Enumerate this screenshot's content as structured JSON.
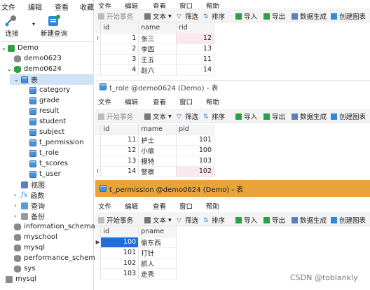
{
  "menubar": [
    "文件",
    "编辑",
    "查看",
    "收藏"
  ],
  "toolbar": {
    "connect": "连接",
    "new_query": "新建查询"
  },
  "tree": {
    "root": "Demo",
    "dbs_top": [
      "demo0623",
      "demo0624"
    ],
    "table_folder": "表",
    "tables": [
      "category",
      "grade",
      "result",
      "student",
      "subject",
      "t_permission",
      "t_role",
      "t_scores",
      "t_user"
    ],
    "folders": [
      "视图",
      "函数",
      "查询",
      "备份"
    ],
    "other_dbs": [
      "information_schema",
      "myschool",
      "mysql",
      "performance_schema",
      "sys"
    ],
    "conn2": "mysql"
  },
  "panel_menu": [
    "文件",
    "编辑",
    "查看",
    "窗口",
    "帮助"
  ],
  "panel_tools": {
    "begin": "开始事务",
    "text": "文本",
    "filter": "筛选",
    "sort": "排序",
    "import": "导入",
    "export": "导出",
    "gen": "数据生成",
    "chart": "创建图表"
  },
  "user_table": {
    "columns": [
      "id",
      "name",
      "rid"
    ],
    "rows": [
      [
        "1",
        "张三",
        "12"
      ],
      [
        "2",
        "李四",
        "13"
      ],
      [
        "3",
        "王五",
        "11"
      ],
      [
        "4",
        "赵六",
        "14"
      ]
    ]
  },
  "role_table": {
    "title": "t_role @demo0624 (Demo) - 表",
    "columns": [
      "id",
      "rname",
      "pid"
    ],
    "rows": [
      [
        "11",
        "护士",
        "101"
      ],
      [
        "12",
        "小偷",
        "100"
      ],
      [
        "13",
        "模特",
        "103"
      ],
      [
        "14",
        "警察",
        "102"
      ]
    ]
  },
  "perm_table": {
    "title": "t_permission @demo0624 (Demo) - 表",
    "columns": [
      "id",
      "pname"
    ],
    "rows": [
      [
        "100",
        "偷东西"
      ],
      [
        "101",
        "打针"
      ],
      [
        "102",
        "抓人"
      ],
      [
        "103",
        "走秀"
      ]
    ]
  },
  "watermark": "CSDN @toblankly",
  "colors": {
    "active_title": "#e8a33b",
    "selection": "#1e6fd9",
    "db_green": "#2ea043"
  }
}
